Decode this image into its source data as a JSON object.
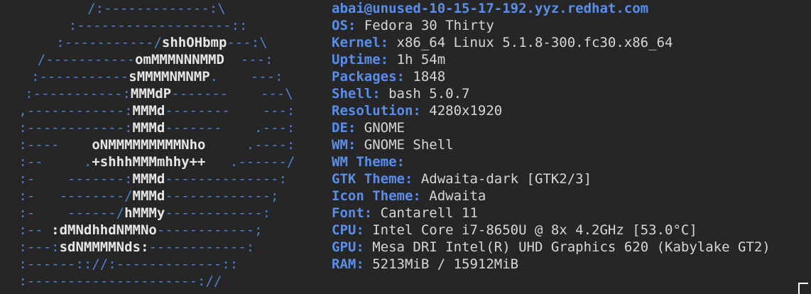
{
  "title": "abai@unused-10-15-17-192.yyz.redhat.com",
  "logo": [
    [
      [
        "/:-------------:\\",
        0
      ]
    ],
    [
      [
        ":-------------------::",
        0
      ]
    ],
    [
      [
        ":-----------/",
        0
      ],
      [
        "shhOHbmp",
        1
      ],
      [
        "---:\\",
        0
      ]
    ],
    [
      [
        "/-----------",
        0
      ],
      [
        "omMMMNNNMMD",
        1
      ],
      [
        "  ---:",
        0
      ]
    ],
    [
      [
        ":-----------",
        0
      ],
      [
        "sMMMMNMNMP",
        1
      ],
      [
        ".    ---:",
        0
      ]
    ],
    [
      [
        ":-----------:",
        0
      ],
      [
        "MMMdP",
        1
      ],
      [
        "-------    ---\\",
        0
      ]
    ],
    [
      [
        ",------------:",
        0
      ],
      [
        "MMMd",
        1
      ],
      [
        "--------    ---:",
        0
      ]
    ],
    [
      [
        ":------------:",
        0
      ],
      [
        "MMMd",
        1
      ],
      [
        "-------    .---:",
        0
      ]
    ],
    [
      [
        ":----    ",
        0
      ],
      [
        "oNMMMMMMMMMNho",
        1
      ],
      [
        "     .----:",
        0
      ]
    ],
    [
      [
        ":--     .",
        0
      ],
      [
        "+shhhMMMmhhy++",
        1
      ],
      [
        "   .------/",
        0
      ]
    ],
    [
      [
        ":-    -------:",
        0
      ],
      [
        "MMMd",
        1
      ],
      [
        "--------------:",
        0
      ]
    ],
    [
      [
        ":-   --------/",
        0
      ],
      [
        "MMMd",
        1
      ],
      [
        "-------------;",
        0
      ]
    ],
    [
      [
        ":-    ------/",
        0
      ],
      [
        "hMMMy",
        1
      ],
      [
        "------------:",
        0
      ]
    ],
    [
      [
        ":-- ",
        0
      ],
      [
        ":dMNdhhdNMMNo",
        1
      ],
      [
        "------------;",
        0
      ]
    ],
    [
      [
        ":---:",
        0
      ],
      [
        "sdNMMMMNds:",
        1
      ],
      [
        "------------:",
        0
      ]
    ],
    [
      [
        ":------:://:-------------::",
        0
      ]
    ],
    [
      [
        ":---------------------://",
        0
      ]
    ]
  ],
  "logo_indent": [
    14,
    11,
    9,
    6,
    5,
    4,
    3,
    3,
    3,
    3,
    3,
    3,
    3,
    3,
    3,
    3,
    3
  ],
  "info": [
    {
      "key": "OS:",
      "value": "Fedora 30 Thirty"
    },
    {
      "key": "Kernel:",
      "value": "x86_64 Linux 5.1.8-300.fc30.x86_64"
    },
    {
      "key": "Uptime:",
      "value": "1h 54m"
    },
    {
      "key": "Packages:",
      "value": "1848"
    },
    {
      "key": "Shell:",
      "value": "bash 5.0.7"
    },
    {
      "key": "Resolution:",
      "value": "4280x1920"
    },
    {
      "key": "DE:",
      "value": "GNOME"
    },
    {
      "key": "WM:",
      "value": "GNOME Shell"
    },
    {
      "key": "WM Theme:",
      "value": ""
    },
    {
      "key": "GTK Theme:",
      "value": "Adwaita-dark [GTK2/3]"
    },
    {
      "key": "Icon Theme:",
      "value": "Adwaita"
    },
    {
      "key": "Font:",
      "value": "Cantarell 11"
    },
    {
      "key": "CPU:",
      "value": "Intel Core i7-8650U @ 8x 4.2GHz [53.0°C]"
    },
    {
      "key": "GPU:",
      "value": "Mesa DRI Intel(R) UHD Graphics 620 (Kabylake GT2)"
    },
    {
      "key": "RAM:",
      "value": "5213MiB / 15912MiB"
    }
  ]
}
